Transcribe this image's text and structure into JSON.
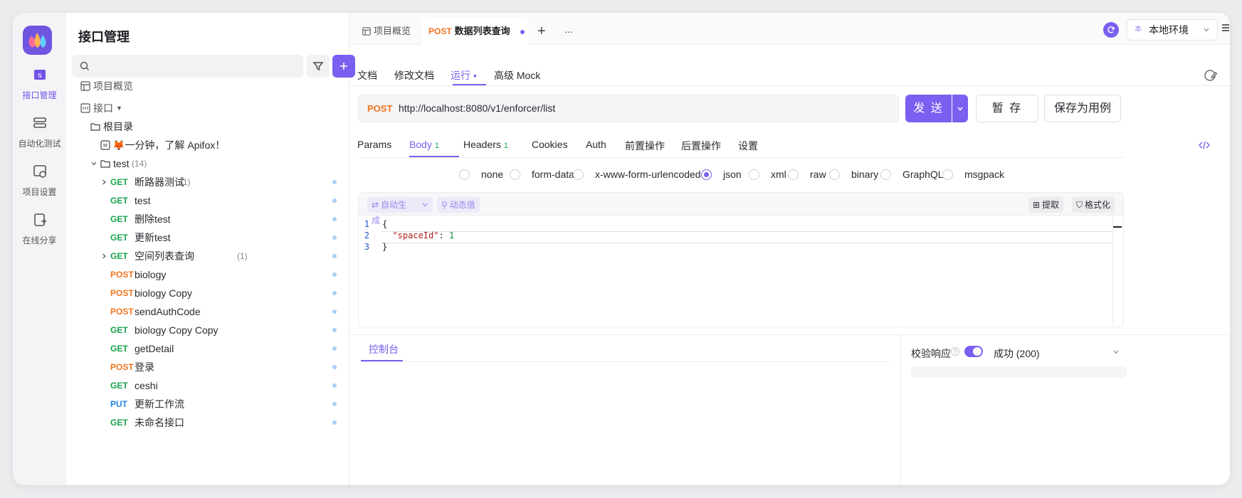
{
  "rail": {
    "items": [
      {
        "label": "接口管理",
        "icon": "api-icon"
      },
      {
        "label": "自动化测试",
        "icon": "automation-icon"
      },
      {
        "label": "项目设置",
        "icon": "project-settings-icon"
      },
      {
        "label": "在线分享",
        "icon": "share-icon"
      }
    ]
  },
  "sidebar": {
    "title": "接口管理",
    "search_placeholder": "",
    "overview": "项目概览",
    "api_root": "接口",
    "root_dir": "根目录",
    "intro": "🦊一分钟，了解 Apifox！",
    "folder": {
      "name": "test",
      "count": "(14)"
    },
    "items": [
      {
        "method": "GET",
        "name": "断路器测试",
        "count": "(1)",
        "expandable": true
      },
      {
        "method": "GET",
        "name": "test"
      },
      {
        "method": "GET",
        "name": "删除test"
      },
      {
        "method": "GET",
        "name": "更新test"
      },
      {
        "method": "GET",
        "name": "空间列表查询",
        "count": "(1)",
        "expandable": true
      },
      {
        "method": "POST",
        "name": "biology"
      },
      {
        "method": "POST",
        "name": "biology Copy"
      },
      {
        "method": "POST",
        "name": "sendAuthCode"
      },
      {
        "method": "GET",
        "name": "biology Copy Copy"
      },
      {
        "method": "GET",
        "name": "getDetail"
      },
      {
        "method": "POST",
        "name": "登录"
      },
      {
        "method": "GET",
        "name": "ceshi"
      },
      {
        "method": "PUT",
        "name": "更新工作流"
      },
      {
        "method": "GET",
        "name": "未命名接口"
      }
    ]
  },
  "tabs": {
    "overview": "项目概览",
    "active_method": "POST",
    "active_name": "数据列表查询",
    "add": "+",
    "more": "···"
  },
  "env": {
    "badge": "本",
    "label": "本地环境"
  },
  "subtabs": [
    "文档",
    "修改文档",
    "运行 •",
    "高级 Mock"
  ],
  "request": {
    "method": "POST",
    "url": "http://localhost:8080/v1/enforcer/list",
    "send": "发 送",
    "save": "暂 存",
    "save_case": "保存为用例"
  },
  "req_tabs": [
    {
      "label": "Params"
    },
    {
      "label": "Body",
      "n": "1"
    },
    {
      "label": "Headers",
      "n": "1"
    },
    {
      "label": "Cookies"
    },
    {
      "label": "Auth"
    },
    {
      "label": "前置操作"
    },
    {
      "label": "后置操作"
    },
    {
      "label": "设置"
    }
  ],
  "body_types": [
    "none",
    "form-data",
    "x-www-form-urlencoded",
    "json",
    "xml",
    "raw",
    "binary",
    "GraphQL",
    "msgpack"
  ],
  "body_selected": "json",
  "editor": {
    "auto_gen": "自动生成",
    "dynamic": "动态值",
    "extract": "提取",
    "format": "格式化",
    "line_numbers": [
      "1",
      "2",
      "3"
    ],
    "lines": [
      "{",
      "  \"spaceId\": 1",
      "}"
    ]
  },
  "response": {
    "console": "控制台",
    "validate": "校验响应",
    "status": "成功 (200)"
  },
  "colors": {
    "accent": "#7b5ff0",
    "get": "#17a34a",
    "post": "#f27520",
    "put": "#1f86e8"
  }
}
